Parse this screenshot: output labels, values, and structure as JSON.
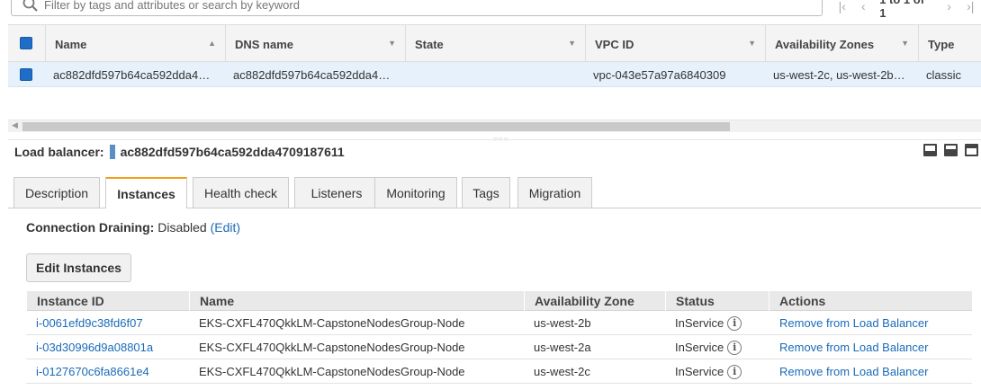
{
  "filter": {
    "placeholder": "Filter by tags and attributes or search by keyword",
    "pager_text": "1 to 1 of 1"
  },
  "grid": {
    "columns": [
      "Name",
      "DNS name",
      "State",
      "VPC ID",
      "Availability Zones",
      "Type"
    ],
    "row": {
      "name": "ac882dfd597b64ca592dda4…",
      "dns": "ac882dfd597b64ca592dda4…",
      "state": "",
      "vpc": "vpc-043e57a97a6840309",
      "azs": "us-west-2c, us-west-2b…",
      "type": "classic"
    }
  },
  "details": {
    "label": "Load balancer:",
    "lb_name": "ac882dfd597b64ca592dda4709187611",
    "tabs": [
      "Description",
      "Instances",
      "Health check",
      "Listeners",
      "Monitoring",
      "Tags",
      "Migration"
    ],
    "active_tab": "Instances",
    "drain_label": "Connection Draining:",
    "drain_value": "Disabled",
    "drain_edit": "(Edit)",
    "edit_button": "Edit Instances"
  },
  "instances": {
    "columns": [
      "Instance ID",
      "Name",
      "Availability Zone",
      "Status",
      "Actions"
    ],
    "rows": [
      {
        "id": "i-0061efd9c38fd6f07",
        "name": "EKS-CXFL470QkkLM-CapstoneNodesGroup-Node",
        "az": "us-west-2b",
        "status": "InService",
        "action": "Remove from Load Balancer"
      },
      {
        "id": "i-03d30996d9a08801a",
        "name": "EKS-CXFL470QkkLM-CapstoneNodesGroup-Node",
        "az": "us-west-2a",
        "status": "InService",
        "action": "Remove from Load Balancer"
      },
      {
        "id": "i-0127670c6fa8661e4",
        "name": "EKS-CXFL470QkkLM-CapstoneNodesGroup-Node",
        "az": "us-west-2c",
        "status": "InService",
        "action": "Remove from Load Balancer"
      }
    ]
  },
  "icons": {
    "search": "search-icon",
    "info": "info-icon",
    "first_page": "first-page-icon",
    "prev_page": "prev-page-icon",
    "next_page": "next-page-icon",
    "last_page": "last-page-icon"
  },
  "colors": {
    "accent_tab": "#f0a01a",
    "link": "#1a6bb8",
    "selected_row": "#e7f1fb",
    "checkbox": "#1f6dc6"
  }
}
